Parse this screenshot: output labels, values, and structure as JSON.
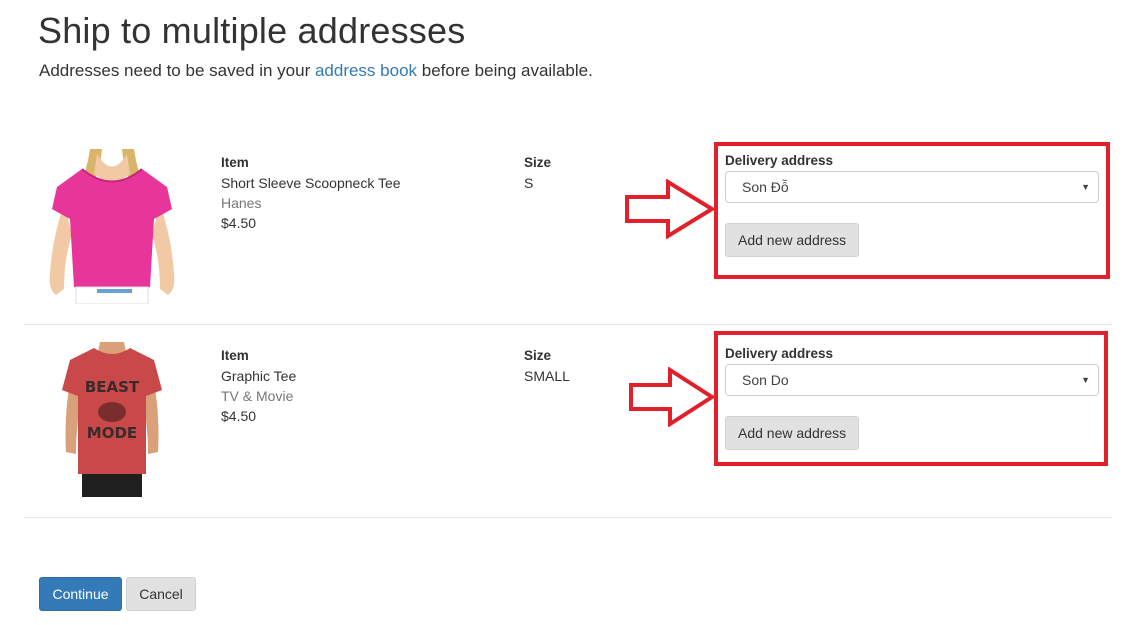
{
  "header": {
    "title": "Ship to multiple addresses",
    "subtitle_before": "Addresses need to be saved in your ",
    "subtitle_link": "address book",
    "subtitle_after": " before being available."
  },
  "items": [
    {
      "item_label": "Item",
      "name": "Short Sleeve Scoopneck Tee",
      "brand": "Hanes",
      "price": "$4.50",
      "size_label": "Size",
      "size": "S",
      "delivery_label": "Delivery address",
      "delivery_value": "Son Đỗ",
      "add_address_label": "Add new address",
      "image_icon": "pink-tshirt-woman-image"
    },
    {
      "item_label": "Item",
      "name": "Graphic Tee",
      "brand": "TV & Movie",
      "price": "$4.50",
      "size_label": "Size",
      "size": "SMALL",
      "delivery_label": "Delivery address",
      "delivery_value": "Son Do",
      "add_address_label": "Add new address",
      "image_icon": "red-graphic-tshirt-image",
      "graphic_text": [
        "BEAST",
        "MODE"
      ]
    }
  ],
  "footer": {
    "continue_label": "Continue",
    "cancel_label": "Cancel"
  },
  "colors": {
    "link": "#337ab7",
    "primary": "#337ab7",
    "highlight": "#e0202a"
  }
}
